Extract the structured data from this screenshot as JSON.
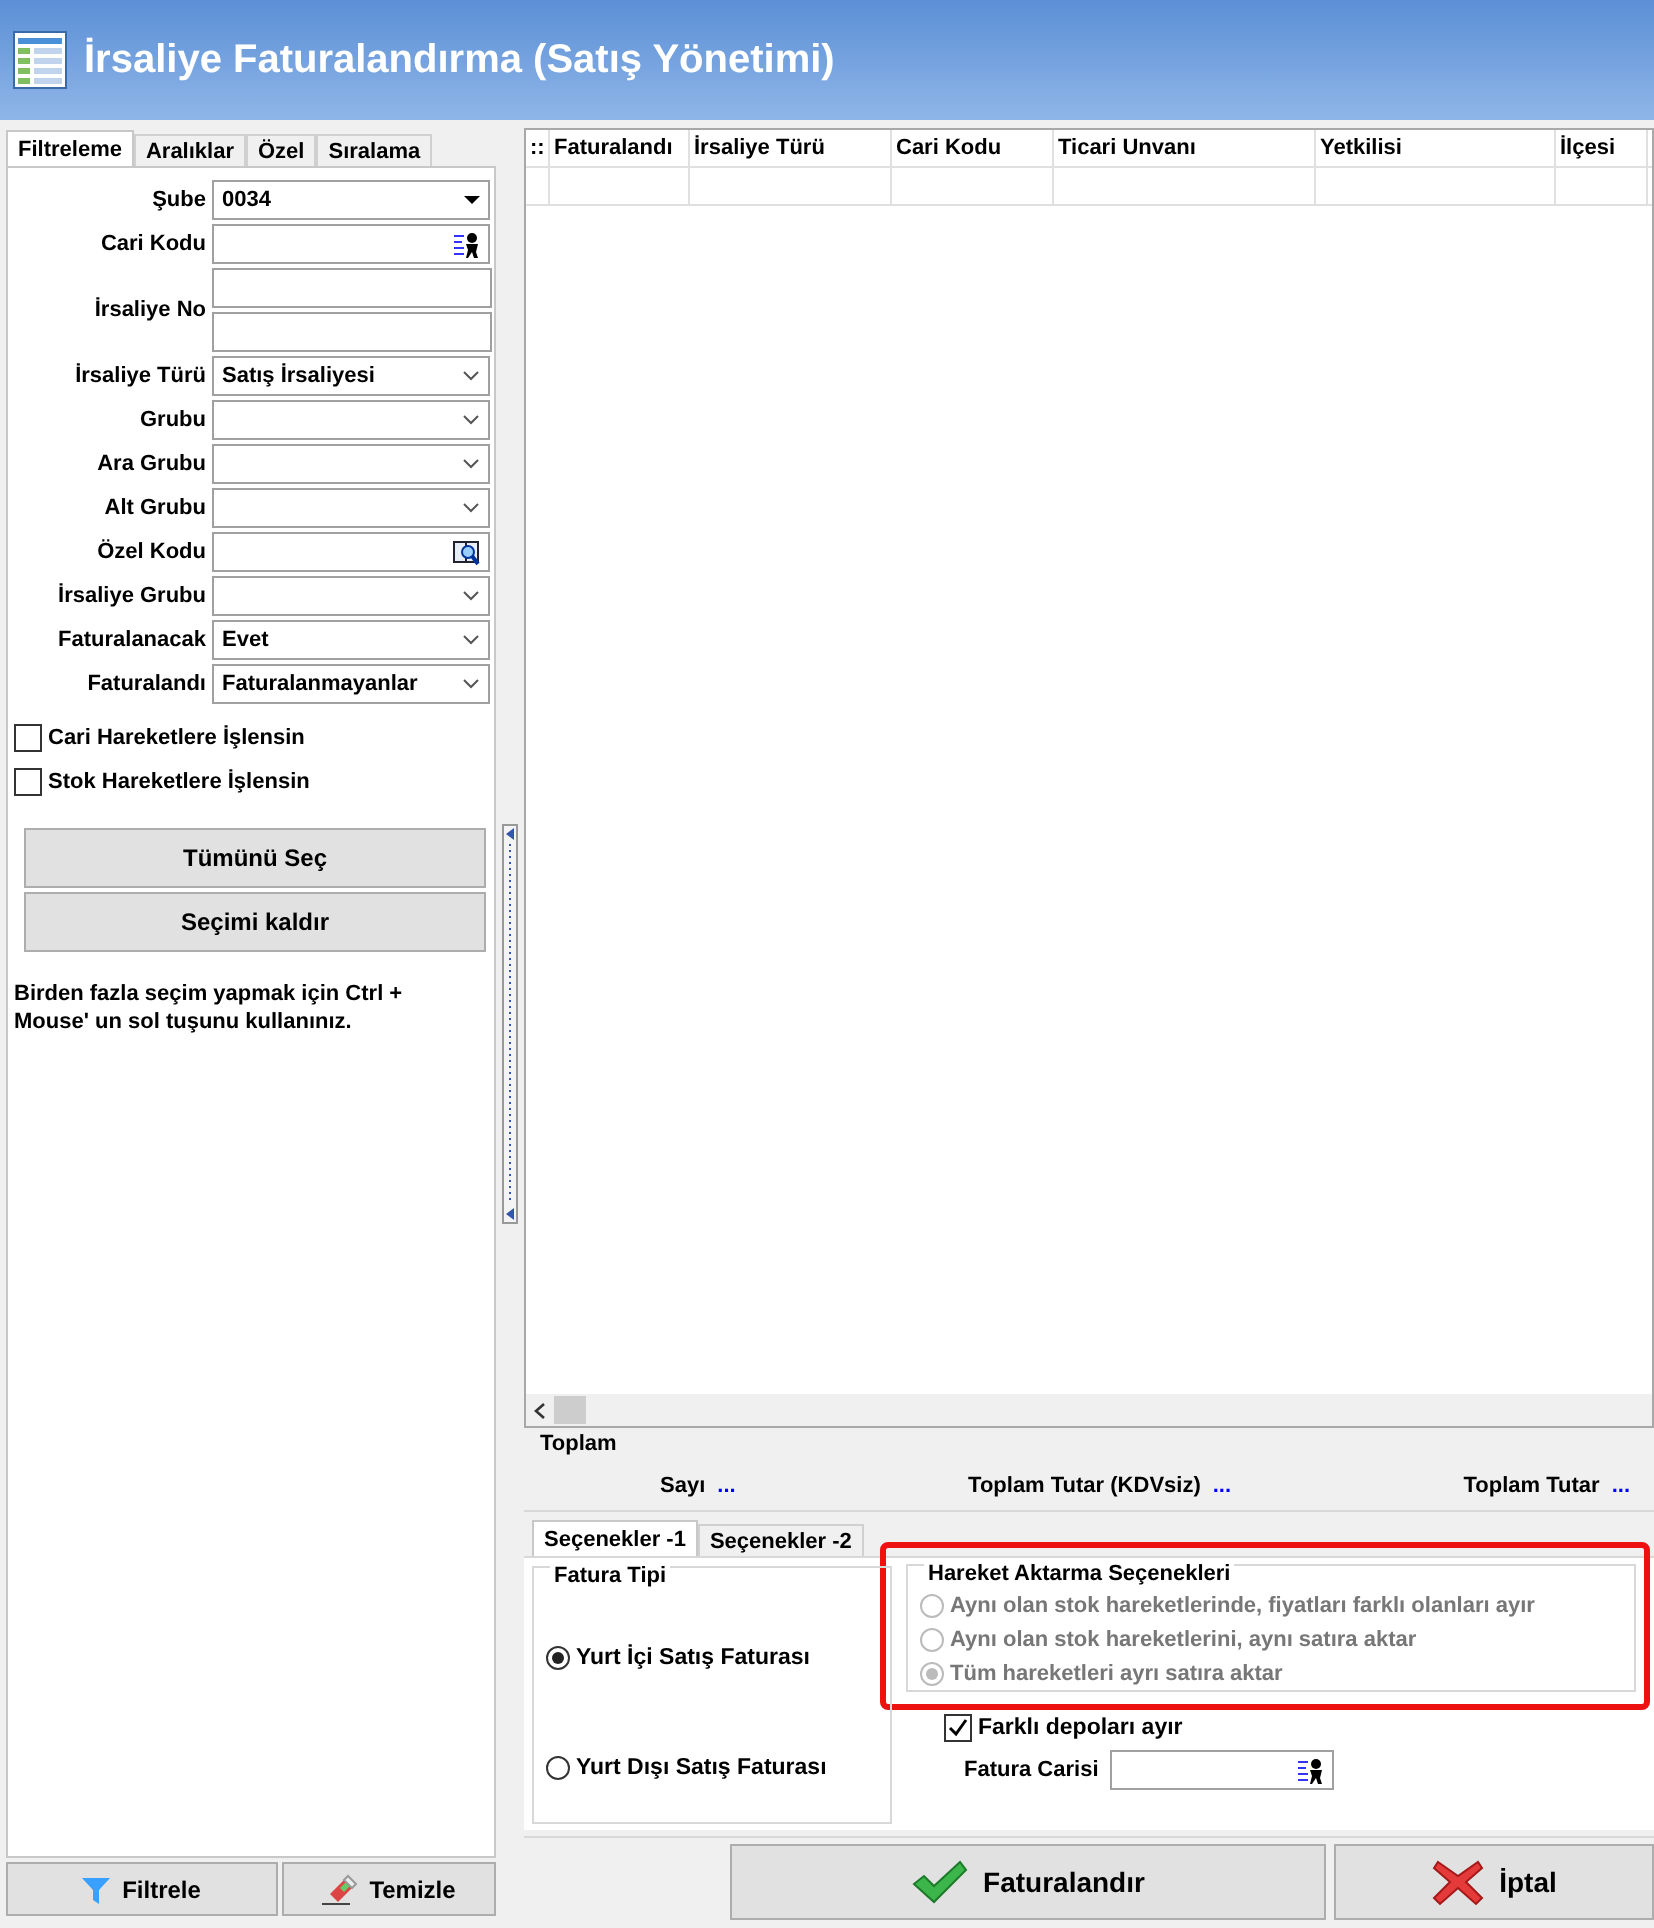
{
  "window": {
    "title": "İrsaliye Faturalandırma (Satış Yönetimi)"
  },
  "filter_tabs": [
    {
      "label": "Filtreleme",
      "selected": true
    },
    {
      "label": "Aralıklar",
      "selected": false
    },
    {
      "label": "Özel",
      "selected": false
    },
    {
      "label": "Sıralama",
      "selected": false
    }
  ],
  "filter_fields": [
    {
      "label": "Şube",
      "kind": "solid",
      "value": "0034"
    },
    {
      "label": "Cari Kodu",
      "kind": "lookup"
    },
    {
      "label": "İrsaliye No",
      "kind": "double"
    },
    {
      "label": "İrsaliye Türü",
      "kind": "combo",
      "value": "Satış İrsaliyesi"
    },
    {
      "label": "Grubu",
      "kind": "combo"
    },
    {
      "label": "Ara Grubu",
      "kind": "combo"
    },
    {
      "label": "Alt Grubu",
      "kind": "combo"
    },
    {
      "label": "Özel Kodu",
      "kind": "search"
    },
    {
      "label": "İrsaliye Grubu",
      "kind": "combo"
    },
    {
      "label": "Faturalanacak",
      "kind": "combo",
      "value": "Evet"
    },
    {
      "label": "Faturalandı",
      "kind": "combo",
      "value": "Faturalanmayanlar"
    }
  ],
  "filter_checks": [
    {
      "label": "Cari Hareketlere İşlensin",
      "checked": false
    },
    {
      "label": "Stok Hareketlere İşlensin",
      "checked": false
    }
  ],
  "select_buttons": [
    "Tümünü Seç",
    "Seçimi kaldır"
  ],
  "hint": "Birden fazla seçim yapmak için Ctrl + Mouse' un sol tuşunu kullanınız.",
  "filter_buttons": [
    {
      "label": "Filtrele",
      "kind": "filter"
    },
    {
      "label": "Temizle",
      "kind": "eraser"
    }
  ],
  "table": {
    "indicator": "::",
    "columns": [
      "Faturalandı",
      "İrsaliye Türü",
      "Cari Kodu",
      "Ticari Unvanı",
      "Yetkilisi",
      "İlçesi"
    ]
  },
  "totals": {
    "title": "Toplam",
    "items": [
      {
        "label": "Sayı",
        "value": "..."
      },
      {
        "label": "Toplam Tutar (KDVsiz)",
        "value": "..."
      },
      {
        "label": "Toplam Tutar",
        "value": "..."
      }
    ]
  },
  "option_tabs": [
    {
      "label": "Seçenekler -1",
      "selected": true
    },
    {
      "label": "Seçenekler -2",
      "selected": false
    }
  ],
  "invoice_type": {
    "title": "Fatura Tipi",
    "options": [
      {
        "label": "Yurt İçi Satış Faturası",
        "selected": true
      },
      {
        "label": "Yurt Dışı Satış Faturası",
        "selected": false
      }
    ]
  },
  "transfer_options": {
    "title": "Hareket Aktarma Seçenekleri",
    "highlighted": true,
    "options": [
      {
        "label": "Aynı olan stok hareketlerinde, fiyatları farklı olanları ayır",
        "selected": false,
        "disabled": true
      },
      {
        "label": "Aynı olan stok hareketlerini, aynı satıra aktar",
        "selected": false,
        "disabled": true
      },
      {
        "label": "Tüm hareketleri ayrı satıra aktar",
        "selected": true,
        "disabled": true
      }
    ]
  },
  "separate_depots": {
    "label": "Farklı depoları ayır",
    "checked": true
  },
  "invoice_account": {
    "label": "Fatura Carisi"
  },
  "actions": [
    {
      "label": "Faturalandır",
      "kind": "confirm"
    },
    {
      "label": "İptal",
      "kind": "cancel"
    }
  ]
}
